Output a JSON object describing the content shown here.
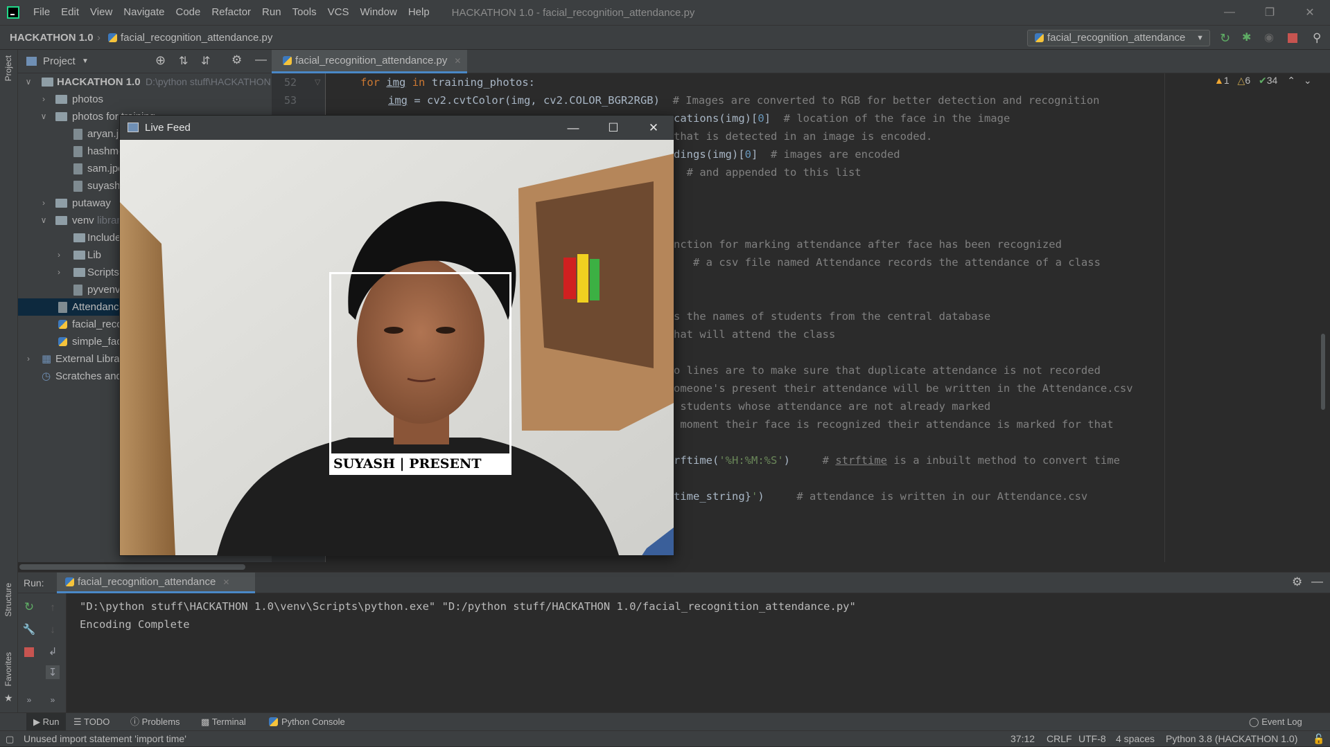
{
  "menubar": {
    "items": [
      "File",
      "Edit",
      "View",
      "Navigate",
      "Code",
      "Refactor",
      "Run",
      "Tools",
      "VCS",
      "Window",
      "Help"
    ],
    "window_title": "HACKATHON 1.0 - facial_recognition_attendance.py"
  },
  "navbar": {
    "project": "HACKATHON 1.0",
    "file": "facial_recognition_attendance.py",
    "run_config": "facial_recognition_attendance"
  },
  "sidebar": {
    "project_label": "Project",
    "structure_label": "Structure",
    "favorites_label": "Favorites"
  },
  "project_panel": {
    "title": "Project",
    "tree": [
      {
        "label": "HACKATHON 1.0",
        "hint": "D:\\python stuff\\HACKATHON 1.0"
      },
      {
        "label": "photos"
      },
      {
        "label": "photos for training"
      },
      {
        "label": "aryan.jpg"
      },
      {
        "label": "hashmeet.jpg"
      },
      {
        "label": "sam.jpeg"
      },
      {
        "label": "suyash.jpg"
      },
      {
        "label": "putaway"
      },
      {
        "label": "venv",
        "hint": "library root"
      },
      {
        "label": "Include"
      },
      {
        "label": "Lib"
      },
      {
        "label": "Scripts"
      },
      {
        "label": "pyvenv.cfg"
      },
      {
        "label": "Attendance.csv"
      },
      {
        "label": "facial_recognition_attendance.py"
      },
      {
        "label": "simple_facerec.py"
      },
      {
        "label": "External Libraries"
      },
      {
        "label": "Scratches and Consoles"
      }
    ]
  },
  "editor": {
    "tab": "facial_recognition_attendance.py",
    "inspections": {
      "warnings": "1",
      "weak_warnings": "6",
      "typos": "34"
    },
    "line_numbers": [
      "52",
      "53"
    ]
  },
  "live_feed": {
    "title": "Live Feed",
    "label": "SUYASH | PRESENT"
  },
  "run_panel": {
    "label": "Run:",
    "tab": "facial_recognition_attendance",
    "console": [
      "\"D:\\python stuff\\HACKATHON 1.0\\venv\\Scripts\\python.exe\" \"D:/python stuff/HACKATHON 1.0/facial_recognition_attendance.py\"",
      "Encoding Complete"
    ]
  },
  "bottom_tabs": {
    "run": "Run",
    "todo": "TODO",
    "problems": "Problems",
    "terminal": "Terminal",
    "python_console": "Python Console",
    "event_log": "Event Log"
  },
  "status": {
    "message": "Unused import statement 'import time'",
    "position": "37:12",
    "line_sep": "CRLF",
    "encoding": "UTF-8",
    "indent": "4 spaces",
    "interpreter": "Python 3.8 (HACKATHON 1.0)"
  },
  "colors": {
    "accent": "#4a88c7",
    "selection": "#0d293e",
    "warning": "#f0a732",
    "ok": "#5fad65",
    "stop": "#c75450"
  }
}
